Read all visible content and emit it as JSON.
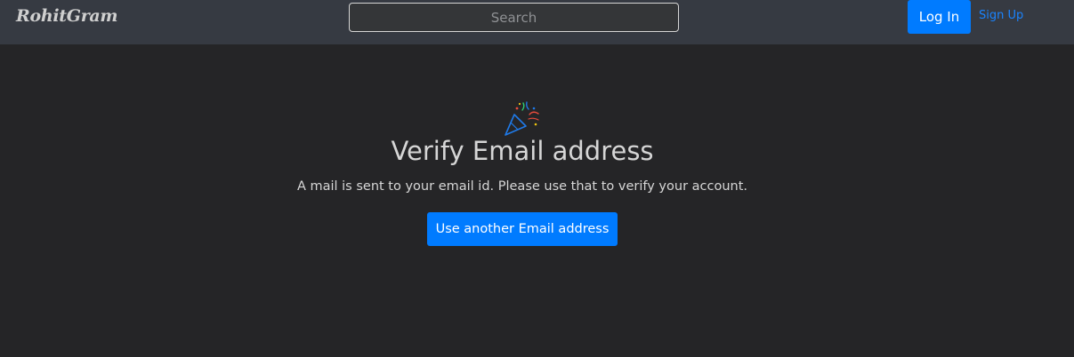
{
  "navbar": {
    "brand": "RohitGram",
    "search_placeholder": "Search",
    "login_label": "Log In",
    "signup_label": "Sign Up"
  },
  "main": {
    "icon": "party-popper-icon",
    "title": "Verify Email address",
    "message": "A mail is sent to your email id. Please use that to verify your account.",
    "button_label": "Use another Email address"
  },
  "colors": {
    "background": "#252527",
    "navbar": "#363a42",
    "accent": "#007bff",
    "text": "#d6d6d6"
  }
}
